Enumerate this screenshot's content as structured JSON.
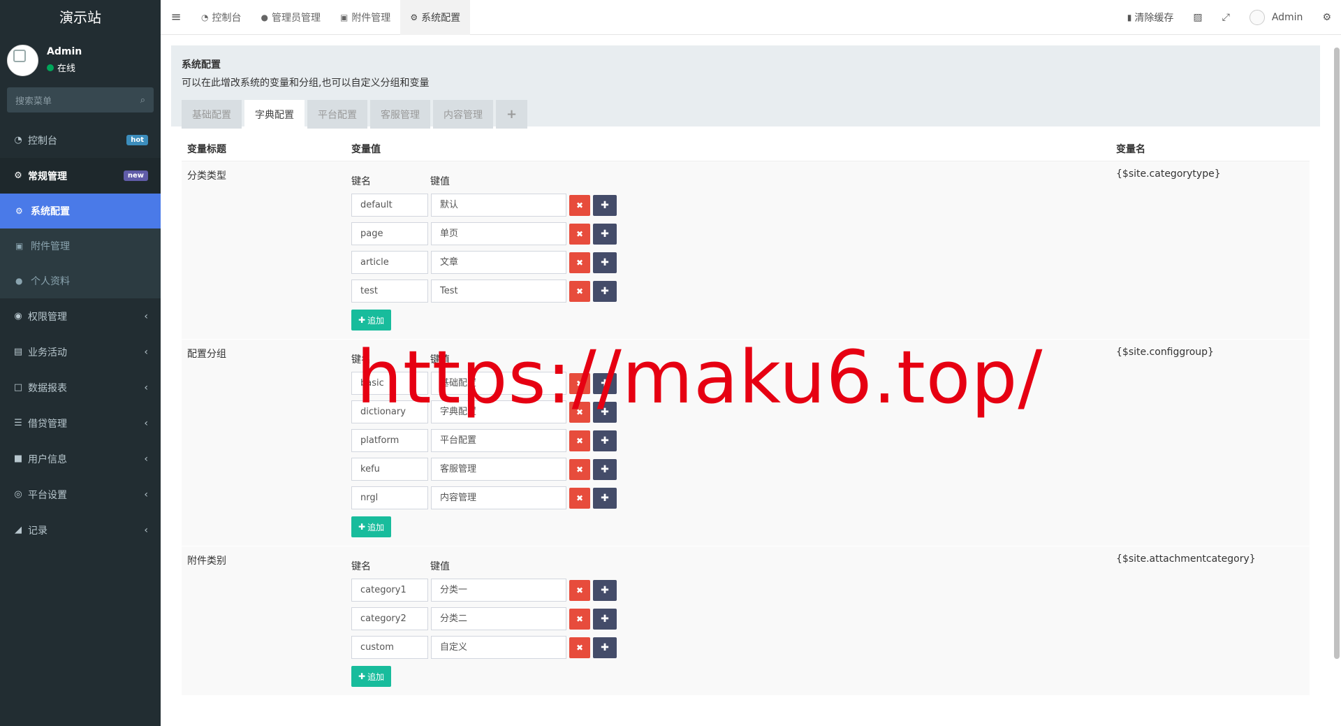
{
  "brand": "演示站",
  "user": {
    "name": "Admin",
    "status": "在线"
  },
  "sidebar": {
    "search_placeholder": "搜索菜单",
    "items": [
      {
        "label": "控制台",
        "icon": "dashboard-icon",
        "badge": "hot"
      },
      {
        "label": "常规管理",
        "icon": "cogs-icon",
        "badge": "new"
      }
    ],
    "submenu": [
      {
        "label": "系统配置",
        "icon": "gear-icon"
      },
      {
        "label": "附件管理",
        "icon": "file-image-icon"
      },
      {
        "label": "个人资料",
        "icon": "user-icon"
      }
    ],
    "groups": [
      {
        "label": "权限管理",
        "icon": "users-icon"
      },
      {
        "label": "业务活动",
        "icon": "id-card-icon"
      },
      {
        "label": "数据报表",
        "icon": "file-icon"
      },
      {
        "label": "借贷管理",
        "icon": "list-icon"
      },
      {
        "label": "用户信息",
        "icon": "address-book-icon"
      },
      {
        "label": "平台设置",
        "icon": "circle-dot-icon"
      },
      {
        "label": "记录",
        "icon": "area-chart-icon"
      }
    ]
  },
  "topbar": {
    "tabs": [
      "控制台",
      "管理员管理",
      "附件管理",
      "系统配置"
    ],
    "clear_cache": "清除缓存",
    "admin": "Admin"
  },
  "panel": {
    "title": "系统配置",
    "desc": "可以在此增改系统的变量和分组,也可以自定义分组和变量",
    "tabs": [
      "基础配置",
      "字典配置",
      "平台配置",
      "客服管理",
      "内容管理"
    ],
    "plus": "+"
  },
  "table": {
    "headers": [
      "变量标题",
      "变量值",
      "变量名"
    ],
    "key_label": "键名",
    "value_label": "键值",
    "add_label": "追加",
    "rows": [
      {
        "title": "分类类型",
        "var": "{$site.categorytype}",
        "pairs": [
          {
            "k": "default",
            "v": "默认"
          },
          {
            "k": "page",
            "v": "单页"
          },
          {
            "k": "article",
            "v": "文章"
          },
          {
            "k": "test",
            "v": "Test"
          }
        ]
      },
      {
        "title": "配置分组",
        "var": "{$site.configgroup}",
        "pairs": [
          {
            "k": "basic",
            "v": "基础配置"
          },
          {
            "k": "dictionary",
            "v": "字典配置"
          },
          {
            "k": "platform",
            "v": "平台配置"
          },
          {
            "k": "kefu",
            "v": "客服管理"
          },
          {
            "k": "nrgl",
            "v": "内容管理"
          }
        ]
      },
      {
        "title": "附件类别",
        "var": "{$site.attachmentcategory}",
        "pairs": [
          {
            "k": "category1",
            "v": "分类一"
          },
          {
            "k": "category2",
            "v": "分类二"
          },
          {
            "k": "custom",
            "v": "自定义"
          }
        ]
      }
    ]
  },
  "watermark": "https://maku6.top/"
}
